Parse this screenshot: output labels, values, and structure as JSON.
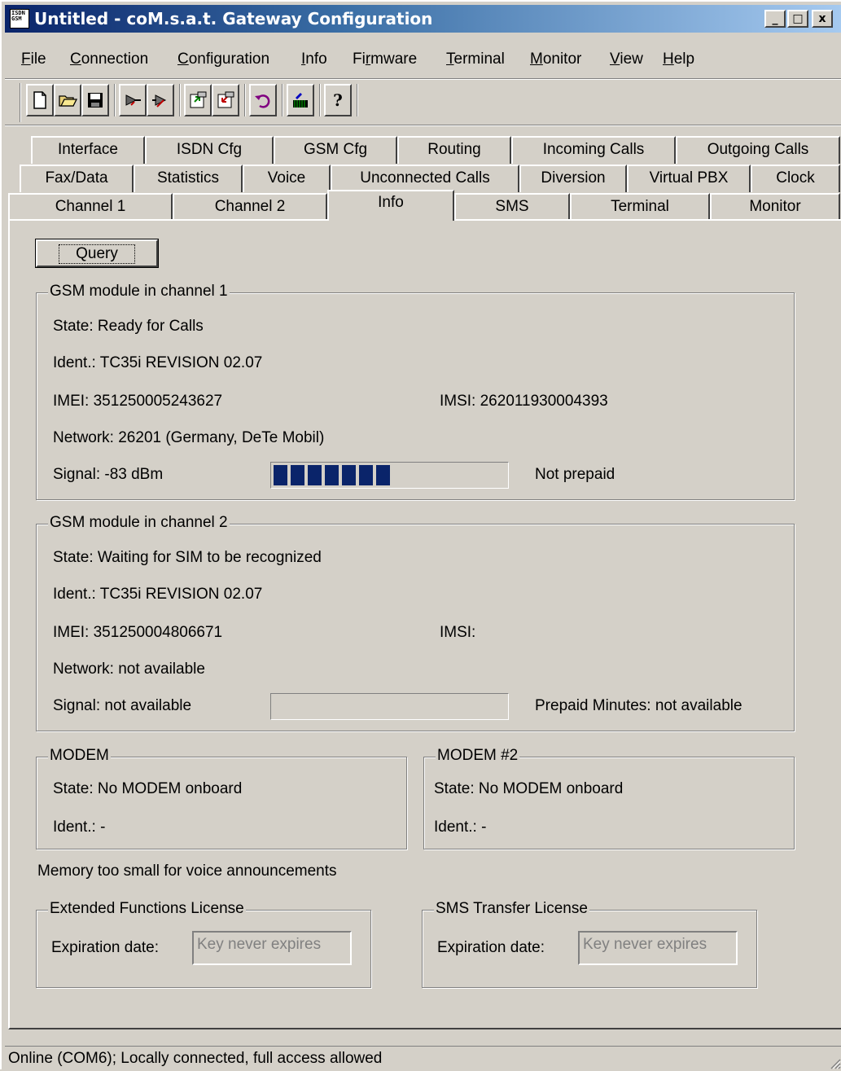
{
  "window": {
    "title": "Untitled - coM.s.a.t. Gateway Configuration",
    "app_icon_text": "ISDN GSM",
    "controls": {
      "minimize": "_",
      "maximize": "□",
      "close": "x"
    }
  },
  "menu": [
    {
      "underline": "F",
      "rest": "ile"
    },
    {
      "underline": "C",
      "rest": "onnection"
    },
    {
      "underline": "C",
      "rest": "onfiguration"
    },
    {
      "underline": "I",
      "rest": "nfo"
    },
    {
      "underline": "F",
      "rest": "irmware",
      "pre": "Fi",
      "post": "mware",
      "mid": "r"
    },
    {
      "underline": "T",
      "rest": "erminal"
    },
    {
      "underline": "M",
      "rest": "onitor"
    },
    {
      "underline": "V",
      "rest": "iew"
    },
    {
      "underline": "H",
      "rest": "elp"
    }
  ],
  "toolbar": {
    "icons": [
      "new-file-icon",
      "open-folder-icon",
      "save-icon",
      "connect-icon",
      "disconnect-icon",
      "upload-config-icon",
      "download-config-icon",
      "undo-icon",
      "firmware-icon",
      "help-icon"
    ]
  },
  "tabs": {
    "row1": [
      "Interface",
      "ISDN Cfg",
      "GSM Cfg",
      "Routing",
      "Incoming Calls",
      "Outgoing Calls"
    ],
    "row2": [
      "Fax/Data",
      "Statistics",
      "Voice",
      "Unconnected Calls",
      "Diversion",
      "Virtual PBX",
      "Clock"
    ],
    "row3": [
      "Channel 1",
      "Channel 2",
      "Info",
      "SMS",
      "Terminal",
      "Monitor"
    ],
    "active": "Info"
  },
  "info": {
    "query_button": "Query",
    "gsm1": {
      "legend": "GSM module in channel 1",
      "state": "State: Ready for Calls",
      "ident": "Ident.: TC35i REVISION 02.07",
      "imei": "IMEI: 351250005243627",
      "imsi": "IMSI: 262011930004393",
      "network": "Network: 26201 (Germany, DeTe Mobil)",
      "signal": "Signal: -83 dBm",
      "signal_segments_filled": 7,
      "signal_segments_total": 15,
      "prepaid": "Not prepaid"
    },
    "gsm2": {
      "legend": "GSM module in channel 2",
      "state": "State: Waiting for SIM to be recognized",
      "ident": "Ident.: TC35i REVISION 02.07",
      "imei": "IMEI: 351250004806671",
      "imsi": "IMSI:",
      "network": "Network: not available",
      "signal": "Signal: not available",
      "signal_segments_filled": 0,
      "signal_segments_total": 15,
      "prepaid": "Prepaid Minutes: not available"
    },
    "modem1": {
      "legend": "MODEM",
      "state": "State: No MODEM onboard",
      "ident": "Ident.: -"
    },
    "modem2": {
      "legend": "MODEM #2",
      "state": "State: No MODEM onboard",
      "ident": "Ident.: -"
    },
    "memory_note": "Memory too small for voice announcements",
    "ext_license": {
      "legend": "Extended Functions License",
      "label": "Expiration date:",
      "value": "Key never expires"
    },
    "sms_license": {
      "legend": "SMS Transfer License",
      "label": "Expiration date:",
      "value": "Key never expires"
    }
  },
  "status": "Online (COM6); Locally connected, full access allowed"
}
